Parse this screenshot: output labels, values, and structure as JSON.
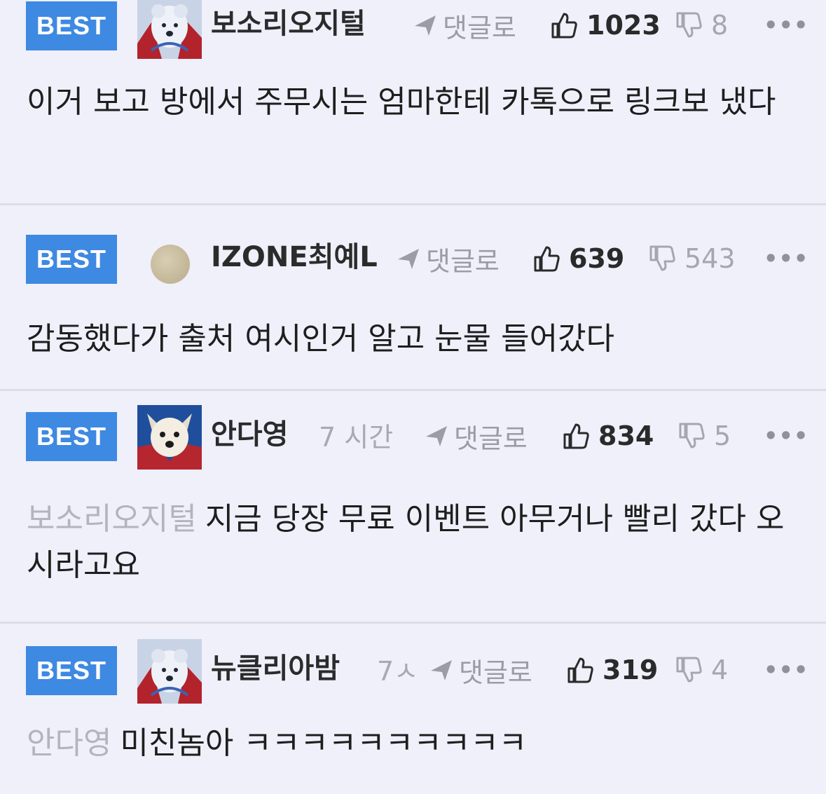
{
  "comments": [
    {
      "badge": "BEST",
      "author": "보소리오지털",
      "avatar": "polar-bear-avatar",
      "time": "",
      "reply_label": "댓글로",
      "likes": "1023",
      "dislikes": "8",
      "more": "•••",
      "mention": "",
      "text": "이거 보고 방에서 주무시는 엄마한테 카톡으로 링크보 냈다"
    },
    {
      "badge": "BEST",
      "author": "IZONE최예L",
      "avatar": "beige-circle-avatar",
      "time": "",
      "reply_label": "댓글로",
      "likes": "639",
      "dislikes": "543",
      "more": "•••",
      "mention": "",
      "text": "감동했다가 출처 여시인거 알고 눈물 들어갔다"
    },
    {
      "badge": "BEST",
      "author": "안다영",
      "avatar": "dog-avatar",
      "time": "7 시간",
      "reply_label": "댓글로",
      "likes": "834",
      "dislikes": "5",
      "more": "•••",
      "mention": "보소리오지털",
      "text": "지금 당장 무료 이벤트 아무거나 빨리 갔다 오시라고요"
    },
    {
      "badge": "BEST",
      "author": "뉴클리아밤",
      "avatar": "polar-bear-avatar",
      "time": "7ㅅ",
      "reply_label": "댓글로",
      "likes": "319",
      "dislikes": "4",
      "more": "•••",
      "mention": "안다영",
      "text": "미친놈아 ㅋㅋㅋㅋㅋㅋㅋㅋㅋㅋ"
    }
  ],
  "colors": {
    "background": "#eff0fa",
    "best_badge": "#3e89e2",
    "muted_text": "#a7a9b3",
    "divider": "#dcdde8"
  }
}
